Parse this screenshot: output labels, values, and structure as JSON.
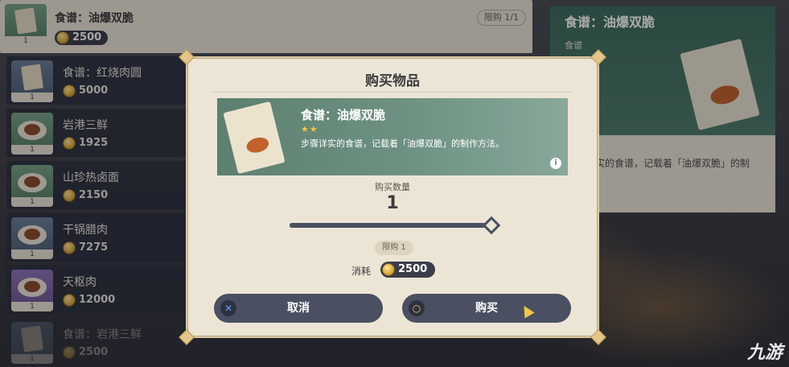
{
  "shop_items": [
    {
      "name": "食谱：油爆双脆",
      "price": "2500",
      "count": "1",
      "limit": "限购 1/1"
    },
    {
      "name": "食谱：红烧肉圆",
      "price": "5000",
      "count": "1"
    },
    {
      "name": "岩港三鲜",
      "price": "1925",
      "count": "1"
    },
    {
      "name": "山珍热卤面",
      "price": "2150",
      "count": "1"
    },
    {
      "name": "干锅腊肉",
      "price": "7275",
      "count": "1"
    },
    {
      "name": "天枢肉",
      "price": "12000",
      "count": "1"
    },
    {
      "name": "食谱：岩港三鲜",
      "price": "2500",
      "count": "1"
    }
  ],
  "detail": {
    "title": "食谱：油爆双脆",
    "type": "食谱",
    "desc": "实的食谱，记载着「油爆双脆」的制"
  },
  "modal": {
    "title": "购买物品",
    "item_name": "食谱：油爆双脆",
    "stars": "★★",
    "item_desc": "步骤详实的食谱，记载着「油爆双脆」的制作方法。",
    "info": "i",
    "qty_label": "购买数量",
    "qty_value": "1",
    "slider_fraction": 1.0,
    "limit": "限购 1",
    "cost_label": "消耗",
    "cost_value": "2500",
    "cancel_label": "取消",
    "buy_label": "购买",
    "cancel_icon": "✕",
    "buy_icon": "○"
  },
  "watermark": "九游",
  "colors": {
    "card_green": "#6e9282",
    "button_dark": "#4a5062",
    "panel_cream": "#ece5d6",
    "coin_gold": "#d9a93a"
  }
}
